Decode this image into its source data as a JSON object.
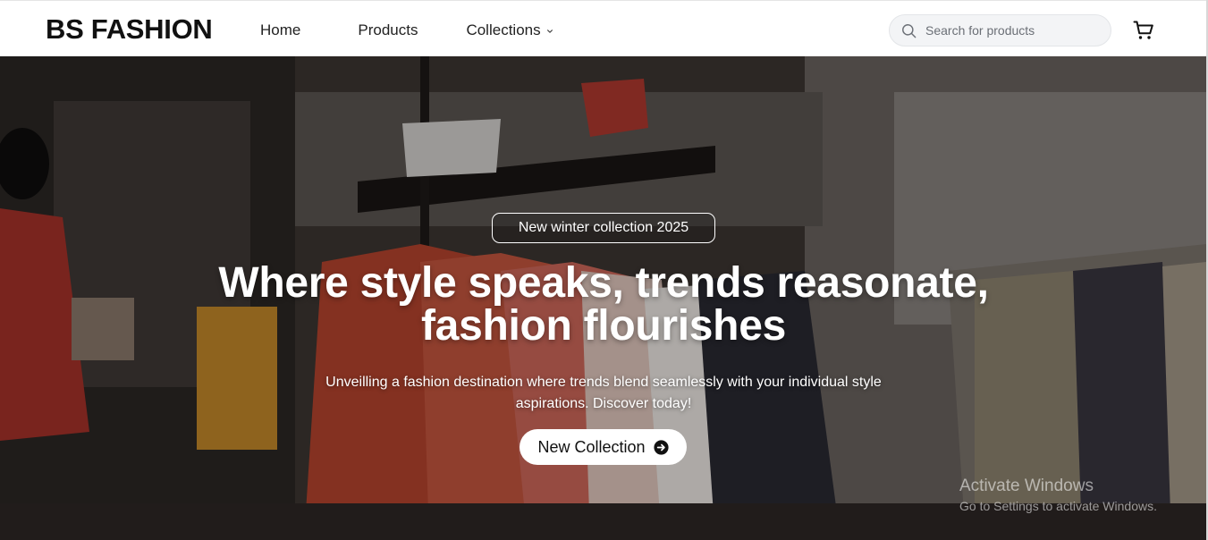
{
  "header": {
    "logo": "BS FASHION",
    "nav": {
      "home": "Home",
      "products": "Products",
      "collections": "Collections"
    },
    "search_placeholder": "Search for products"
  },
  "hero": {
    "badge": "New winter collection 2025",
    "title_line1": "Where style speaks, trends reasonate,",
    "title_line2": "fashion flourishes",
    "subtitle_line1": "Unveilling a fashion destination where trends blend seamlessly with your individual style",
    "subtitle_line2": "aspirations. Discover today!",
    "cta_label": "New Collection"
  },
  "watermark": {
    "line1": "Activate Windows",
    "line2": "Go to Settings to activate Windows."
  },
  "icons": {
    "search": "search-icon",
    "cart": "cart-icon",
    "chevron": "chevron-down-icon",
    "cta_arrow": "arrow-right-circle-icon"
  }
}
